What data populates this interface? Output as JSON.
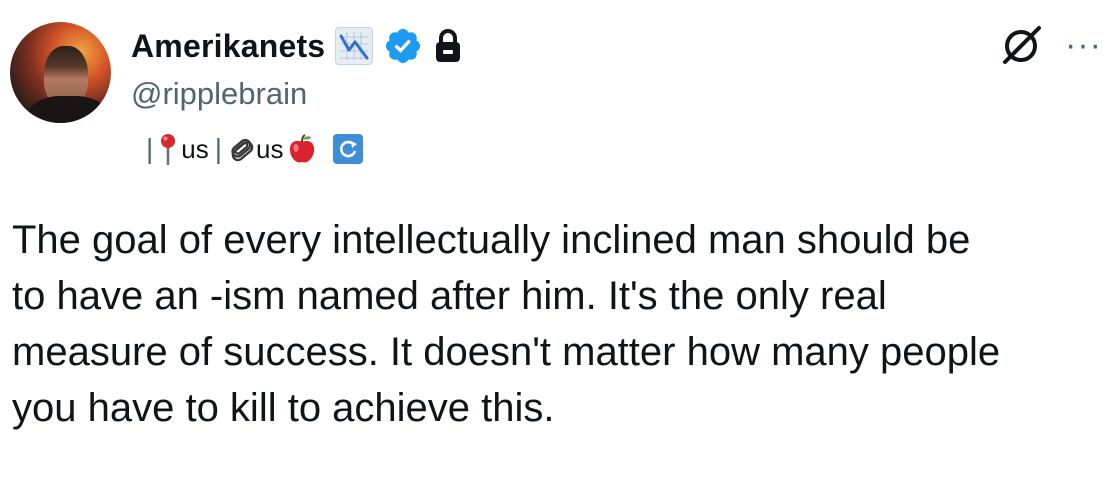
{
  "author": {
    "display_name": "Amerikanets",
    "handle": "@ripplebrain",
    "bio_line": {
      "sep1": "|",
      "pin_icon": "round-pushpin-emoji",
      "text1": "us",
      "sep2": "|",
      "paperclip_icon": "paperclips-emoji",
      "text2": "us",
      "apple_icon": "red-apple-emoji",
      "refresh_icon": "counterclockwise-arrows-emoji"
    },
    "badges": [
      "chart-decreasing-emoji",
      "verified-icon",
      "lock-icon"
    ]
  },
  "actions": {
    "grok_icon": "grok-icon",
    "more_label": "···"
  },
  "tweet": {
    "text": "The goal of every intellectually inclined man should be\nto have an -ism named after him. It's the only real\nmeasure of success. It doesn't matter how many people\nyou have to kill to achieve this."
  },
  "colors": {
    "primary_text": "#0f1419",
    "secondary_text": "#536471",
    "verified_blue": "#1d9bf0"
  }
}
